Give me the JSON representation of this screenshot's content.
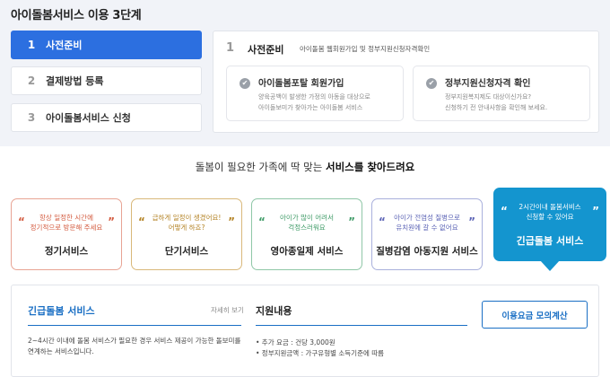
{
  "heading": "아이돌봄서비스 이용 3단계",
  "steps": [
    {
      "num": "1",
      "label": "사전준비"
    },
    {
      "num": "2",
      "label": "결제방법 등록"
    },
    {
      "num": "3",
      "label": "아이돌봄서비스 신청"
    }
  ],
  "detail": {
    "num": "1",
    "title": "사전준비",
    "desc": "아이돌봄 웹회원가입 및 정부지원신청자격확인",
    "cards": [
      {
        "title": "아이돌봄포탈 회원가입",
        "desc": [
          "양육공백이 발생한 가정의 아동을 대상으로",
          "아이돌보미가 찾아가는 아이돌봄 서비스"
        ]
      },
      {
        "title": "정부지원신청자격 확인",
        "desc": [
          "정부지원복지제도 대상이신가요?",
          "신청하기 전 안내사항을 확인해 보세요."
        ]
      }
    ]
  },
  "tagline": {
    "prefix": "돌봄이 필요한 가족에 딱 맞는 ",
    "emphasis": "서비스를 찾아드려요"
  },
  "services": [
    {
      "desc": [
        "항상 일정한 시간에",
        "정기적으로 방문해 주세요"
      ],
      "name": "정기서비스"
    },
    {
      "desc": [
        "급하게 일정이 생겼어요!",
        "어떻게 하죠?"
      ],
      "name": "단기서비스"
    },
    {
      "desc": [
        "아이가 많이 어려서",
        "걱정스러워요"
      ],
      "name": "영아종일제 서비스"
    },
    {
      "desc": [
        "아이가 전염성 질병으로",
        "유치원에 갈 수 없어요"
      ],
      "name": "질병감염 아동지원 서비스"
    },
    {
      "desc": [
        "2시간이내 돌봄서비스",
        "신청할 수 있어요"
      ],
      "name": "긴급돌봄 서비스"
    }
  ],
  "quote_open": "“",
  "quote_close": "”",
  "bottom": {
    "title": "긴급돌봄 서비스",
    "more": "자세히 보기",
    "desc": [
      "2~4시간 이내에 돌봄 서비스가 필요한 경우 서비스 제공이 가능한 돌보미를",
      "연계하는 서비스입니다."
    ],
    "support_title": "지원내용",
    "support": [
      "• 추가 요금 : 건당 3,000원",
      "• 정부지원금액 : 가구유형별 소득기준에 따름"
    ],
    "calc_button": "이용요금 모의계산"
  },
  "colors": {
    "primary": "#2c6fe0",
    "emergency": "#1495cf",
    "regular": "#d35a3e",
    "short": "#b38223",
    "infant": "#3f9b67",
    "illness": "#5b63b5"
  }
}
